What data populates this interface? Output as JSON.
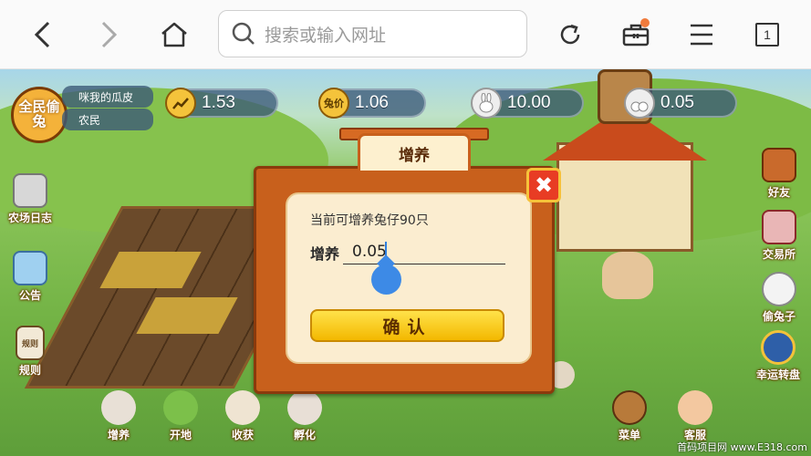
{
  "browser": {
    "address_placeholder": "搜索或输入网址",
    "tab_count": "1"
  },
  "player": {
    "badge": "全民偷兔",
    "name": "咪我的瓜皮",
    "rank": "农民"
  },
  "stats": [
    {
      "icon": "chart-icon",
      "value": "1.53"
    },
    {
      "icon_text": "兔价",
      "value": "1.06"
    },
    {
      "icon": "rabbit-icon",
      "value": "10.00"
    },
    {
      "icon": "rabbits-icon",
      "value": "0.05"
    }
  ],
  "left_menu": [
    "农场日志",
    "公告",
    "规则"
  ],
  "right_menu": [
    "好友",
    "交易所",
    "偷兔子",
    "幸运转盘"
  ],
  "bottom_menu": [
    "增养",
    "开地",
    "收获",
    "孵化",
    "菜单",
    "客服"
  ],
  "rules_icon_text": "规则",
  "dialog": {
    "title": "增养",
    "hint": "当前可增养兔仔90只",
    "field_label": "增养",
    "field_value": "0.05",
    "confirm": "确认"
  },
  "watermark": "首码项目网 www.E318.com",
  "colors": {
    "accent": "#3d8ae6",
    "dialog_frame": "#c8601c",
    "confirm": "#f3b800"
  }
}
